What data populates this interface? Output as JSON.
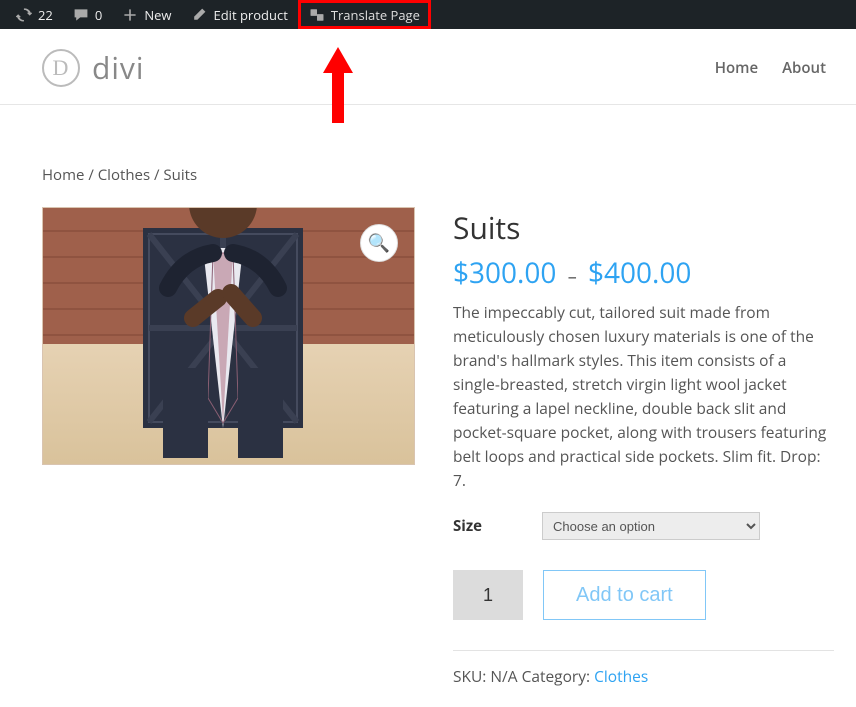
{
  "adminbar": {
    "update_count": "22",
    "comment_count": "0",
    "new_label": "New",
    "edit_label": "Edit product",
    "translate_label": "Translate Page"
  },
  "header": {
    "logo_text": "divi",
    "nav": {
      "home": "Home",
      "about": "About"
    }
  },
  "breadcrumb": {
    "home": "Home",
    "clothes": "Clothes",
    "current": "Suits"
  },
  "product": {
    "title": "Suits",
    "price_low_symbol": "$",
    "price_low": "300.00",
    "price_dash": "–",
    "price_high_symbol": "$",
    "price_high": "400.00",
    "description": "The impeccably cut, tailored suit made from meticulously chosen luxury materials is one of the brand's hallmark styles. This item consists of a single-breasted, stretch virgin light wool jacket featuring a lapel neckline, double back slit and pocket-square pocket, along with trousers featuring belt loops and practical side pockets. Slim fit. Drop: 7.",
    "size_label": "Size",
    "size_placeholder": "Choose an option",
    "qty_value": "1",
    "add_to_cart": "Add to cart",
    "sku_label": "SKU: ",
    "sku_value": "N/A",
    "category_label": " Category: ",
    "category_value": "Clothes"
  },
  "icons": {
    "zoom": "🔍"
  }
}
